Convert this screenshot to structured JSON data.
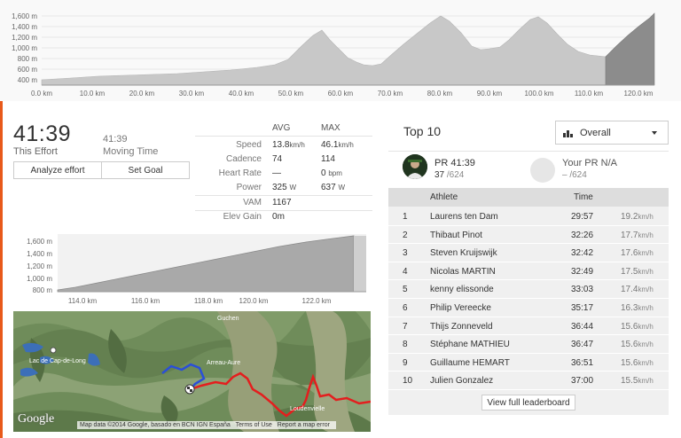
{
  "top_profile": {
    "y_ticks": [
      "1,600 m",
      "1,400 m",
      "1,200 m",
      "1,000 m",
      "800 m",
      "600 m",
      "400 m"
    ],
    "x_ticks": [
      "0.0 km",
      "10.0 km",
      "20.0 km",
      "30.0 km",
      "40.0 km",
      "50.0 km",
      "60.0 km",
      "70.0 km",
      "80.0 km",
      "90.0 km",
      "100.0 km",
      "110.0 km",
      "120.0 km"
    ]
  },
  "effort": {
    "time": "41:39",
    "time_label": "This Effort",
    "moving_time": "41:39",
    "moving_label": "Moving Time",
    "analyze_label": "Analyze effort",
    "goal_label": "Set Goal"
  },
  "stats": {
    "avg_header": "AVG",
    "max_header": "MAX",
    "speed": {
      "label": "Speed",
      "avg": "13.8",
      "avg_unit": "km/h",
      "max": "46.1",
      "max_unit": "km/h"
    },
    "cadence": {
      "label": "Cadence",
      "avg": "74",
      "max": "114"
    },
    "heart": {
      "label": "Heart Rate",
      "avg": "—",
      "max": "0",
      "max_unit": "bpm"
    },
    "power": {
      "label": "Power",
      "avg": "325",
      "avg_unit": "W",
      "max": "637",
      "max_unit": "W"
    },
    "vam": {
      "label": "VAM",
      "avg": "1167"
    },
    "elev": {
      "label": "Elev Gain",
      "avg": "0",
      "avg_unit": "m"
    }
  },
  "segment_profile": {
    "y_ticks": [
      "1,600 m",
      "1,400 m",
      "1,200 m",
      "1,000 m",
      "800 m"
    ],
    "x_ticks": [
      "114.0 km",
      "116.0 km",
      "118.0 km",
      "120.0 km",
      "122.0 km"
    ]
  },
  "map": {
    "logo": "Google",
    "attribution": "Map data ©2014 Google, basado en BCN IGN España",
    "terms": "Terms of Use",
    "report": "Report a map error",
    "place_guchen": "Guchen",
    "place_aure": "Arreau-Aure",
    "place_loudenvielle": "Loudenvielle",
    "place_lake": "Lac de Cap-de-Long"
  },
  "leaderboard": {
    "title": "Top 10",
    "filter": "Overall",
    "pr_value": "PR 41:39",
    "pr_rank": "37",
    "pr_total": "/624",
    "your_pr": "Your PR N/A",
    "your_pr_rank": "– /624",
    "col_athlete": "Athlete",
    "col_time": "Time",
    "speed_unit": "km/h",
    "rows": [
      {
        "rank": "1",
        "name": "Laurens ten Dam",
        "time": "29:57",
        "speed": "19.2"
      },
      {
        "rank": "2",
        "name": "Thibaut Pinot",
        "time": "32:26",
        "speed": "17.7"
      },
      {
        "rank": "3",
        "name": "Steven Kruijswijk",
        "time": "32:42",
        "speed": "17.6"
      },
      {
        "rank": "4",
        "name": "Nicolas MARTIN",
        "time": "32:49",
        "speed": "17.5"
      },
      {
        "rank": "5",
        "name": "kenny elissonde",
        "time": "33:03",
        "speed": "17.4"
      },
      {
        "rank": "6",
        "name": "Philip Vereecke",
        "time": "35:17",
        "speed": "16.3"
      },
      {
        "rank": "7",
        "name": "Thijs Zonneveld",
        "time": "36:44",
        "speed": "15.6"
      },
      {
        "rank": "8",
        "name": "Stéphane MATHIEU",
        "time": "36:47",
        "speed": "15.6"
      },
      {
        "rank": "9",
        "name": "Guillaume HEMART",
        "time": "36:51",
        "speed": "15.6"
      },
      {
        "rank": "10",
        "name": "Julien Gonzalez",
        "time": "37:00",
        "speed": "15.5"
      }
    ],
    "view_full": "View full leaderboard"
  },
  "colors": {
    "accent": "#e8591a",
    "route_red": "#e41e1e",
    "route_blue": "#2a4fd8",
    "profile_fill": "#c8c8c8",
    "highlight_fill": "#8c8c8c"
  }
}
